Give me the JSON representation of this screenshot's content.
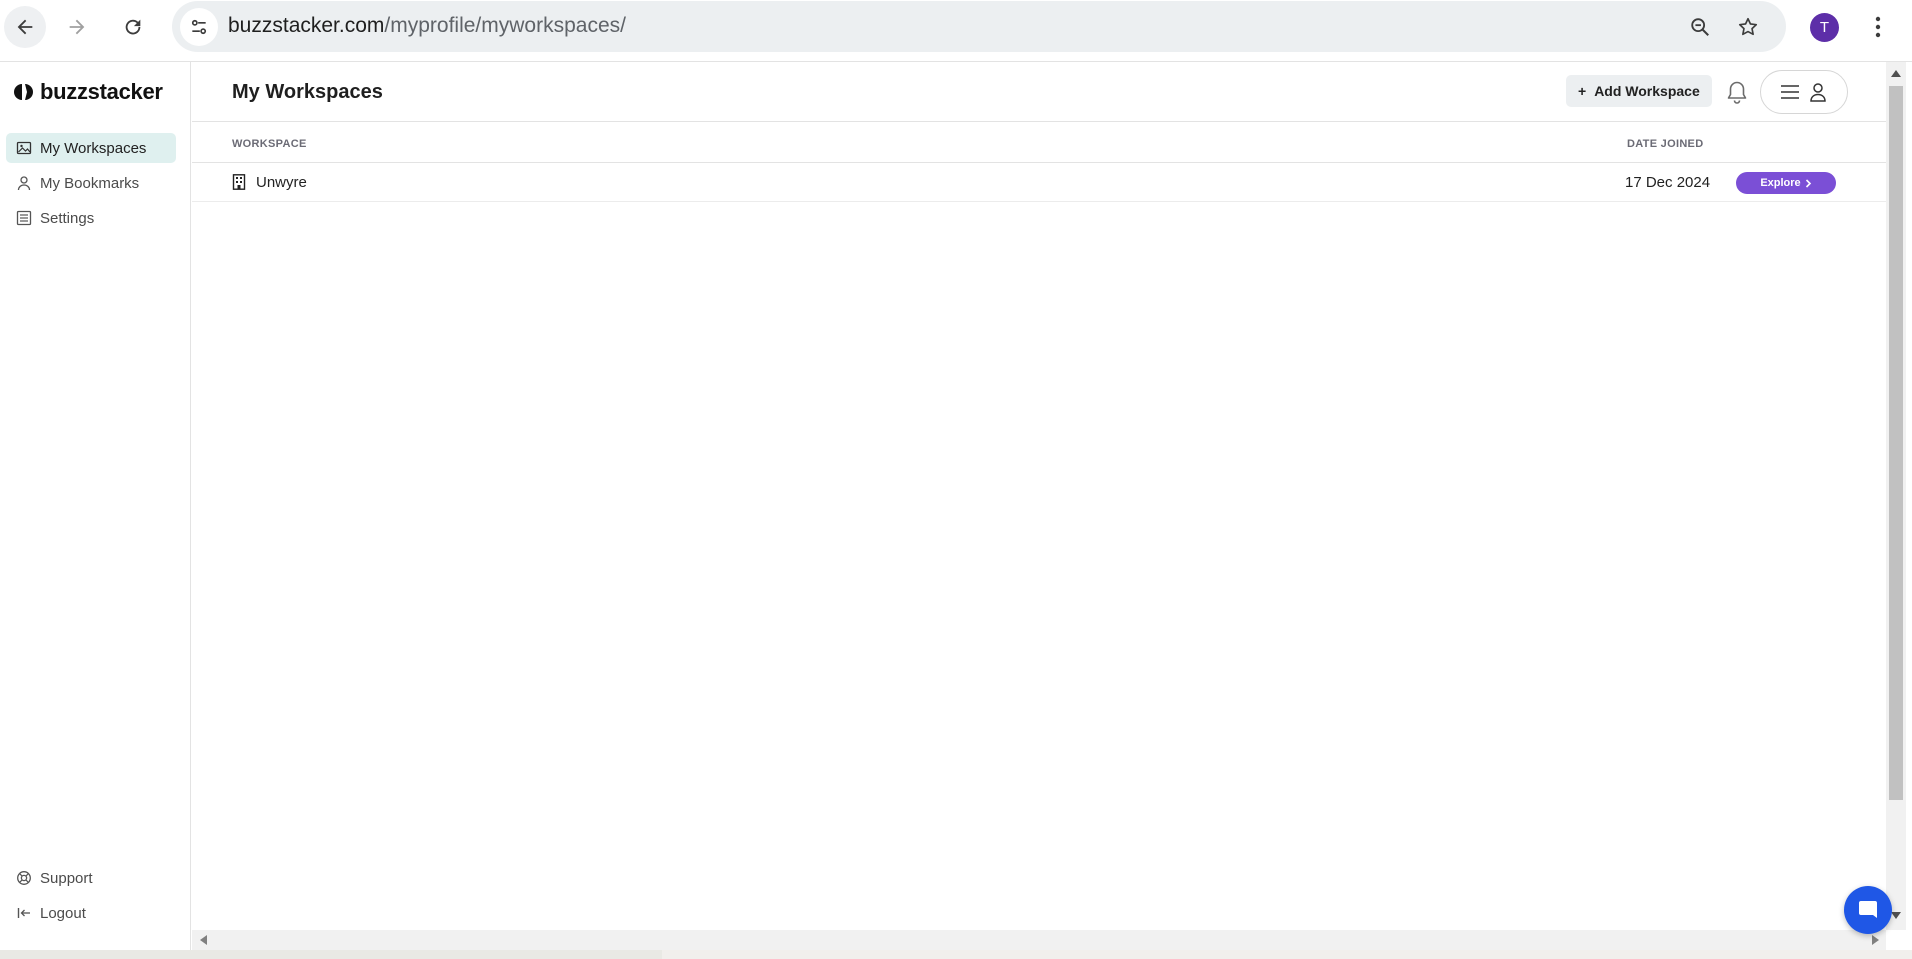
{
  "browser": {
    "url_domain": "buzzstacker.com",
    "url_path": "/myprofile/myworkspaces/",
    "profile_initial": "T"
  },
  "sidebar": {
    "brand": "buzzstacker",
    "items": [
      {
        "label": "My Workspaces",
        "icon": "image-icon",
        "active": true
      },
      {
        "label": "My Bookmarks",
        "icon": "person-icon",
        "active": false
      },
      {
        "label": "Settings",
        "icon": "list-icon",
        "active": false
      }
    ],
    "footer": [
      {
        "label": "Support",
        "icon": "lifebuoy-icon"
      },
      {
        "label": "Logout",
        "icon": "logout-icon"
      }
    ]
  },
  "header": {
    "title": "My Workspaces",
    "add_button_label": "Add Workspace",
    "add_button_prefix": "+"
  },
  "table": {
    "columns": [
      "WORKSPACE",
      "DATE JOINED"
    ],
    "rows": [
      {
        "workspace": "Unwyre",
        "date_joined": "17 Dec 2024",
        "action_label": "Explore"
      }
    ]
  },
  "colors": {
    "accent": "#7b4fd6",
    "active_nav_bg": "#dff0ef",
    "chat_bubble": "#1f57e6",
    "profile_avatar": "#5d2ea8"
  }
}
